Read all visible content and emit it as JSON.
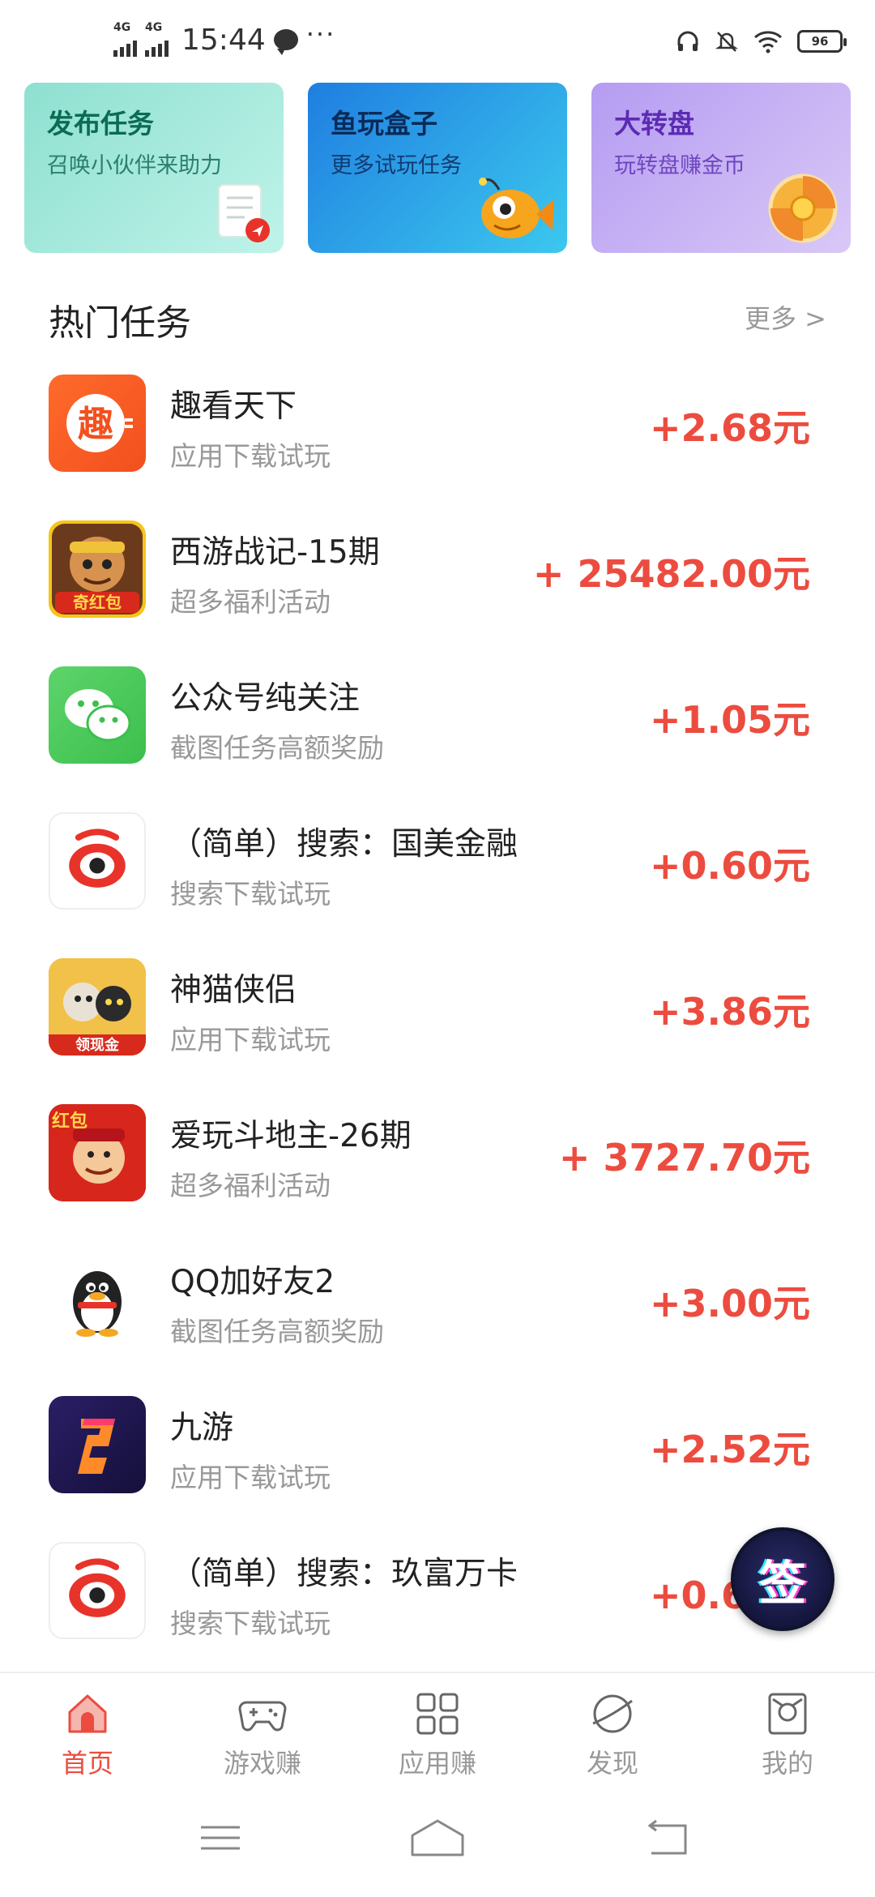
{
  "status_bar": {
    "network_1": "4G",
    "network_2": "4G",
    "time": "15:44",
    "battery": "96"
  },
  "feature_cards": [
    {
      "title": "发布任务",
      "subtitle": "召唤小伙伴来助力"
    },
    {
      "title": "鱼玩盒子",
      "subtitle": "更多试玩任务"
    },
    {
      "title": "大转盘",
      "subtitle": "玩转盘赚金币"
    }
  ],
  "hot_section": {
    "title": "热门任务",
    "more": "更多 >"
  },
  "tasks": [
    {
      "name": "趣看天下",
      "desc": "应用下载试玩",
      "reward": "+2.68元",
      "icon_text": "趣"
    },
    {
      "name": "西游战记-15期",
      "desc": "超多福利活动",
      "reward": "+ 25482.00元",
      "icon_text": "奇红包"
    },
    {
      "name": "公众号纯关注",
      "desc": "截图任务高额奖励",
      "reward": "+1.05元"
    },
    {
      "name": "（简单）搜索：国美金融",
      "desc": "搜索下载试玩",
      "reward": "+0.60元"
    },
    {
      "name": "神猫侠侣",
      "desc": "应用下载试玩",
      "reward": "+3.86元",
      "icon_text": "领现金"
    },
    {
      "name": "爱玩斗地主-26期",
      "desc": "超多福利活动",
      "reward": "+ 3727.70元",
      "icon_text": "红包"
    },
    {
      "name": "QQ加好友2",
      "desc": "截图任务高额奖励",
      "reward": "+3.00元"
    },
    {
      "name": "九游",
      "desc": "应用下载试玩",
      "reward": "+2.52元"
    },
    {
      "name": "（简单）搜索：玖富万卡",
      "desc": "搜索下载试玩",
      "reward": "+0.60元"
    }
  ],
  "sign_button": {
    "label": "签"
  },
  "bottom_nav": [
    {
      "label": "首页",
      "icon": "home-icon",
      "active": true
    },
    {
      "label": "游戏赚",
      "icon": "gamepad-icon"
    },
    {
      "label": "应用赚",
      "icon": "apps-grid-icon"
    },
    {
      "label": "发现",
      "icon": "planet-icon"
    },
    {
      "label": "我的",
      "icon": "profile-bag-icon"
    }
  ],
  "colors": {
    "accent": "#ec4c3f",
    "muted": "#999999",
    "text": "#222222"
  }
}
